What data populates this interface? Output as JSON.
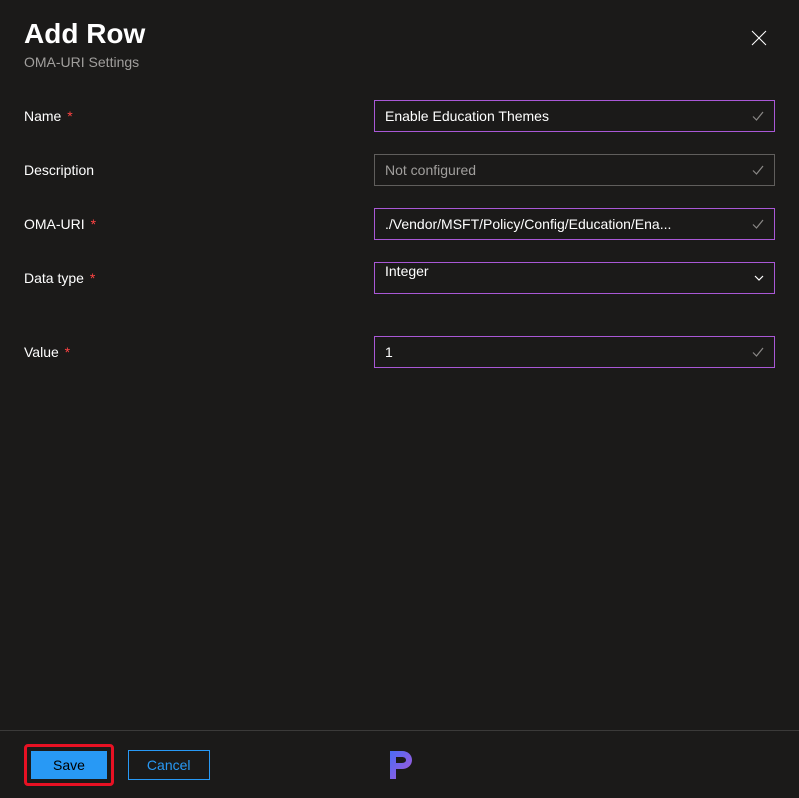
{
  "header": {
    "title": "Add Row",
    "subtitle": "OMA-URI Settings"
  },
  "form": {
    "name": {
      "label": "Name",
      "required": "*",
      "value": "Enable Education Themes"
    },
    "description": {
      "label": "Description",
      "placeholder": "Not configured",
      "value": ""
    },
    "omauri": {
      "label": "OMA-URI",
      "required": "*",
      "value": "./Vendor/MSFT/Policy/Config/Education/Ena..."
    },
    "datatype": {
      "label": "Data type",
      "required": "*",
      "value": "Integer"
    },
    "value": {
      "label": "Value",
      "required": "*",
      "value": "1"
    }
  },
  "footer": {
    "save": "Save",
    "cancel": "Cancel"
  }
}
